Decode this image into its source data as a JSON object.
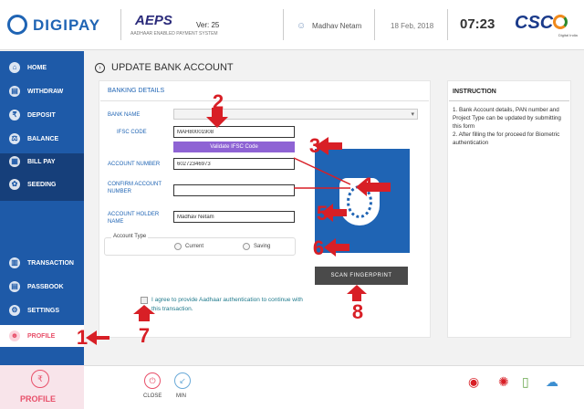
{
  "header": {
    "app_name": "DIGIPAY",
    "partner_logo": "AEPS",
    "partner_sub": "AADHAAR ENABLED PAYMENT SYSTEM",
    "version": "Ver: 25",
    "user_name": "Madhav Netam",
    "date": "18 Feb, 2018",
    "time": "07:23",
    "brand": "CSC",
    "di_text": "Digital India"
  },
  "sidebar": {
    "items": [
      {
        "label": "HOME",
        "icon": "home-icon",
        "glyph": "⌂"
      },
      {
        "label": "WITHDRAW",
        "icon": "withdraw-icon",
        "glyph": "▤"
      },
      {
        "label": "DEPOSIT",
        "icon": "deposit-icon",
        "glyph": "₹"
      },
      {
        "label": "BALANCE",
        "icon": "balance-icon",
        "glyph": "⚖"
      },
      {
        "label": "BILL PAY",
        "icon": "bill-icon",
        "glyph": "▦"
      },
      {
        "label": "SEEDING",
        "icon": "seeding-icon",
        "glyph": "✿"
      },
      {
        "label": "TRANSACTION",
        "icon": "transaction-icon",
        "glyph": "▥"
      },
      {
        "label": "PASSBOOK",
        "icon": "passbook-icon",
        "glyph": "▤"
      },
      {
        "label": "SETTINGS",
        "icon": "gear-icon",
        "glyph": "⚙"
      },
      {
        "label": "PROFILE",
        "icon": "profile-icon",
        "glyph": "☻"
      }
    ]
  },
  "page": {
    "title": "UPDATE BANK ACCOUNT",
    "section": "BANKING DETAILS"
  },
  "form": {
    "bank_name_label": "BANK NAME",
    "bank_name_value": "",
    "ifsc_label": "IFSC CODE",
    "ifsc_value": "MAH80001908",
    "validate_label": "Validate IFSC Code",
    "account_number_label": "ACCOUNT NUMBER",
    "account_number_value": "60272346973",
    "confirm_label": "CONFIRM ACCOUNT NUMBER",
    "confirm_value": "",
    "holder_label": "ACCOUNT HOLDER NAME",
    "holder_value": "Madhav Netam",
    "account_type_label": "Account Type",
    "opt_current": "Current",
    "opt_saving": "Saving",
    "scan_label": "SCAN FINGERPRINT",
    "agree_text": "I agree to provide Aadhaar authentication to continue with this transaction."
  },
  "instruction": {
    "title": "INSTRUCTION",
    "item1": "1. Bank Account details, PAN number and Project Type can be updated by submitting this form",
    "item2": "2. After filling the for proceed for Biometric authentication"
  },
  "annotations": [
    "1",
    "2",
    "3",
    "4",
    "5",
    "6",
    "7",
    "8"
  ],
  "bottom": {
    "profile_label": "PROFILE",
    "close_label": "CLOSE",
    "min_label": "MIN"
  },
  "colors": {
    "primary": "#1f64b4",
    "annotation": "#d81f26",
    "profile": "#e8506a",
    "validate": "#8e63d4"
  }
}
